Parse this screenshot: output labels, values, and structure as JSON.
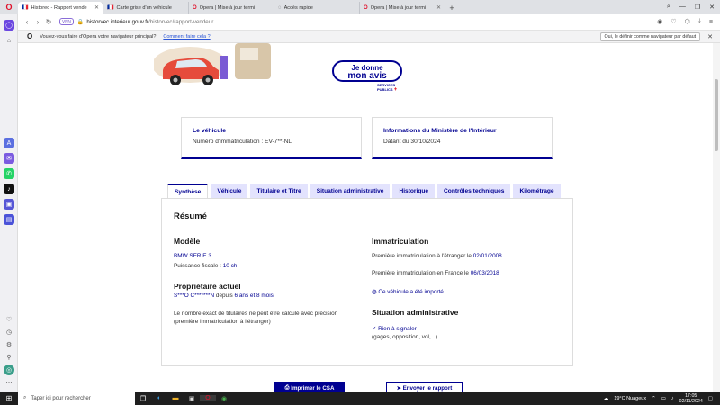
{
  "browser": {
    "tabs": [
      {
        "flag": "🇫🇷",
        "title": "Historec - Rapport vende",
        "active": true
      },
      {
        "flag": "🇫🇷",
        "title": "Carte grise d'un véhicule"
      },
      {
        "flag": "O",
        "title": "Opera | Mise à jour termi"
      },
      {
        "flag": "◌",
        "title": "Accès rapide"
      },
      {
        "flag": "O",
        "title": "Opera | Mise à jour termi"
      }
    ],
    "vpn_label": "VPN",
    "url_domain": "historvec.interieur.gouv.fr",
    "url_path": "/historvec/rapport-vendeur",
    "notification": {
      "text": "Voulez-vous faire d'Opera votre navigateur principal?",
      "link": "Comment faire cela ?",
      "button": "Oui, le définir comme navigateur par défaut"
    }
  },
  "page": {
    "avis": {
      "line1": "Je donne",
      "line2": "mon avis"
    },
    "services_publics": [
      "SERVICES",
      "PUBLICS"
    ],
    "vehicle_card": {
      "title": "Le véhicule",
      "value": "Numéro d'immatriculation : EV-7**-NL"
    },
    "ministry_card": {
      "title": "Informations du Ministère de l'Intérieur",
      "value": "Datant du 30/10/2024"
    },
    "tabs": [
      "Synthèse",
      "Véhicule",
      "Titulaire et Titre",
      "Situation administrative",
      "Historique",
      "Contrôles techniques",
      "Kilométrage"
    ],
    "summary": {
      "title": "Résumé",
      "modele_title": "Modèle",
      "model": "BMW SERIE 3",
      "fiscal_label": "Puissance fiscale : ",
      "fiscal_value": "10 ch",
      "owner_title": "Propriétaire actuel",
      "owner_name": "S***O C*******N",
      "owner_since_label": " depuis ",
      "owner_since": "6 ans et 8 mois",
      "note_line1": "Le nombre exact de titulaires ne peut être calculé avec précision",
      "note_line2": "(première immatriculation à l'étranger)",
      "immat_title": "Immatriculation",
      "first_foreign_label": "Première immatriculation à l'étranger le ",
      "first_foreign_date": "02/01/2008",
      "first_france_label": "Première immatriculation en France le ",
      "first_france_date": "06/03/2018",
      "imported": "Ce véhicule a été importé",
      "admin_title": "Situation administrative",
      "nothing": "Rien à signaler",
      "nothing_detail": "(gages, opposition, vol,...)"
    },
    "buttons": {
      "print": "Imprimer le CSA",
      "send": "Envoyer le rapport"
    }
  },
  "taskbar": {
    "search_placeholder": "Taper ici pour rechercher",
    "weather": "19°C  Nuageux",
    "time": "17:05",
    "date": "02/11/2024"
  },
  "colors": {
    "primary": "#000091",
    "tab_bg": "#e3e3fd",
    "opera_red": "#e0102a"
  }
}
